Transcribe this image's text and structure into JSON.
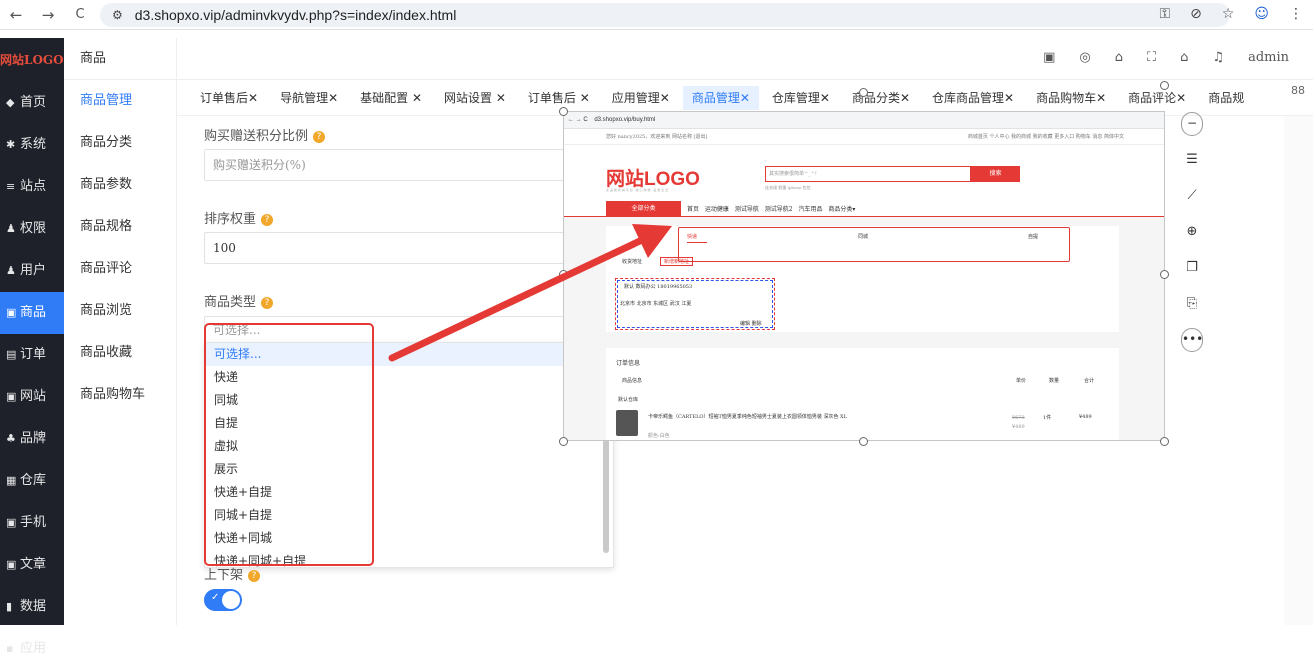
{
  "browser": {
    "url": "d3.shopxo.vip/adminvkvydv.php?s=index/index.html",
    "back_icon": "←",
    "forward_icon": "→",
    "reload_icon": "C",
    "site_icon": "⚙",
    "key_icon": "⚿",
    "eye_off_icon": "⊘",
    "star_icon": "☆",
    "profile_icon": "☺",
    "menu_icon": "⋮"
  },
  "sidebar": {
    "logo": "网站LOGO",
    "items": [
      {
        "icon": "◆",
        "label": "首页"
      },
      {
        "icon": "✱",
        "label": "系统"
      },
      {
        "icon": "≡",
        "label": "站点"
      },
      {
        "icon": "♟",
        "label": "权限"
      },
      {
        "icon": "♟",
        "label": "用户"
      },
      {
        "icon": "▣",
        "label": "商品"
      },
      {
        "icon": "▤",
        "label": "订单"
      },
      {
        "icon": "▣",
        "label": "网站"
      },
      {
        "icon": "♣",
        "label": "品牌"
      },
      {
        "icon": "▦",
        "label": "仓库"
      },
      {
        "icon": "▣",
        "label": "手机"
      },
      {
        "icon": "▣",
        "label": "文章"
      },
      {
        "icon": "▮",
        "label": "数据"
      },
      {
        "icon": "▪",
        "label": "应用"
      }
    ],
    "active_index": 5
  },
  "subnav": {
    "title": "商品",
    "items": [
      "商品管理",
      "商品分类",
      "商品参数",
      "商品规格",
      "商品评论",
      "商品浏览",
      "商品收藏",
      "商品购物车"
    ],
    "active_index": 0
  },
  "topbar": {
    "tools": [
      "▣",
      "◎",
      "⌂",
      "⛶",
      "⌂",
      "♫"
    ],
    "user": "admin"
  },
  "tabs": {
    "items": [
      "订单售后✕",
      "导航管理✕",
      "基础配置 ✕",
      "网站设置 ✕",
      "订单售后 ✕",
      "应用管理✕",
      "商品管理✕",
      "仓库管理✕",
      "商品分类✕",
      "仓库商品管理✕",
      "商品购物车✕",
      "商品评论✕",
      "商品规"
    ],
    "active_index": 6,
    "more_icon": "88"
  },
  "form": {
    "points_label": "购买赠送积分比例",
    "points_placeholder": "购买赠送积分(%)",
    "sort_label": "排序权重",
    "sort_value": "100",
    "type_label": "商品类型",
    "type_placeholder": "可选择...",
    "shelf_label": "上下架",
    "shelf_on": true,
    "help_icon": "?"
  },
  "dropdown": {
    "options": [
      "可选择...",
      "快递",
      "同城",
      "自提",
      "虚拟",
      "展示",
      "快递+自提",
      "同城+自提",
      "快递+同城",
      "快递+同城+自提"
    ],
    "selected_index": 0
  },
  "screenshot": {
    "url": "d3.shopxo.vip/buy.html",
    "topstrip_left": "您好 nancy2025，欢迎来到 网站名称 [退出]",
    "topstrip_right": "商城首页  个人中心  我的商城  我的收藏  更多入口  购物车  消息  简体中文",
    "logo": "网站LOGO",
    "logo_sub": "全 品 类 商 城 平 台 · 放 心 购 物 · 品 质 生 活",
    "search_placeholder": "其实搜索很简单^_^!",
    "search_button": "搜索",
    "hot": "连衣裙  帆篷  iphone  包包",
    "all_categories": "全部分类",
    "nav": "首页  运动健康  测试导航  测试导航2  汽车用品  商品分类▾",
    "delivery_tabs": [
      "快递",
      "同城",
      "自提"
    ],
    "address_label": "收货地址",
    "address_add": "新增新地址",
    "addr_name": "默认  数码办公  18019965053",
    "addr_detail": "北京市 北京市 东城区 武汉 江夏",
    "addr_actions": "编辑  删除",
    "order_title": "订单信息",
    "order_cols": [
      "商品信息",
      "单价",
      "数量",
      "合计"
    ],
    "warehouse": "默认仓库",
    "product": "卡帝乐鳄鱼（CARTELO）短袖T恤男夏季纯色短袖男士夏装上衣圆领体恤男装 深灰色 XL",
    "price_old": "¥673",
    "price": "¥489",
    "qty": "1件",
    "total": "¥489",
    "color": "颜色:白色"
  },
  "right_tools": [
    "−",
    "☰",
    "⟋",
    "⊕",
    "❐",
    "⎘",
    "•••"
  ],
  "colors": {
    "accent": "#2f7cf6",
    "red": "#e53935",
    "sidebar": "#1e2129"
  }
}
